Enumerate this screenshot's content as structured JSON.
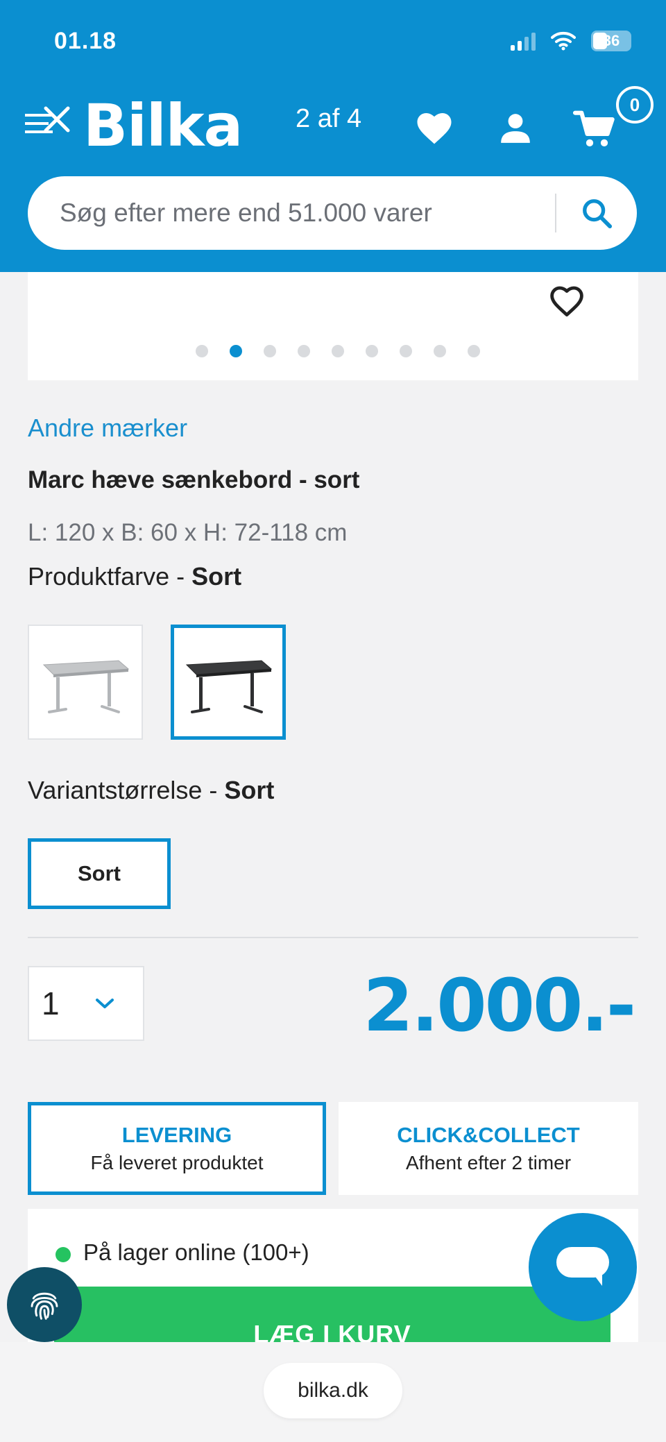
{
  "status_bar": {
    "time": "01.18",
    "battery": "36"
  },
  "header": {
    "logo": "Bilka",
    "pager": "2 af 4",
    "cart_count": "0",
    "search_placeholder": "Søg efter mere end 51.000 varer"
  },
  "gallery": {
    "dots_total": 9,
    "active_dot": 2
  },
  "product": {
    "brand": "Andre mærker",
    "title": "Marc hæve sænkebord - sort",
    "dimensions": "L: 120 x B: 60 x H: 72-118 cm",
    "color_label": "Produktfarve - ",
    "color_value": "Sort",
    "variants": [
      {
        "name": "grey-desk",
        "selected": false
      },
      {
        "name": "black-desk",
        "selected": true
      }
    ],
    "size_label": "Variantstørrelse - ",
    "size_value": "Sort",
    "size_button": "Sort",
    "quantity": "1",
    "price": "2.000.-"
  },
  "delivery": {
    "tabs": [
      {
        "title": "LEVERING",
        "subtitle": "Få leveret produktet",
        "active": true
      },
      {
        "title": "CLICK&COLLECT",
        "subtitle": "Afhent efter 2 timer",
        "active": false
      }
    ],
    "stock_text": "På lager online (100+)",
    "add_to_cart": "LÆG I KURV"
  },
  "browser": {
    "url": "bilka.dk"
  },
  "colors": {
    "brand_blue": "#0b8fd0",
    "stock_green": "#25c360",
    "add_button_green": "#27c062",
    "fingerprint_bg": "#0f4f66"
  },
  "icons": [
    "menu-close-icon",
    "heart-icon",
    "user-icon",
    "cart-icon",
    "search-icon",
    "wishlist-heart-icon",
    "chevron-down-icon",
    "chat-icon",
    "fingerprint-icon",
    "signal-icon",
    "wifi-icon",
    "battery-icon"
  ]
}
